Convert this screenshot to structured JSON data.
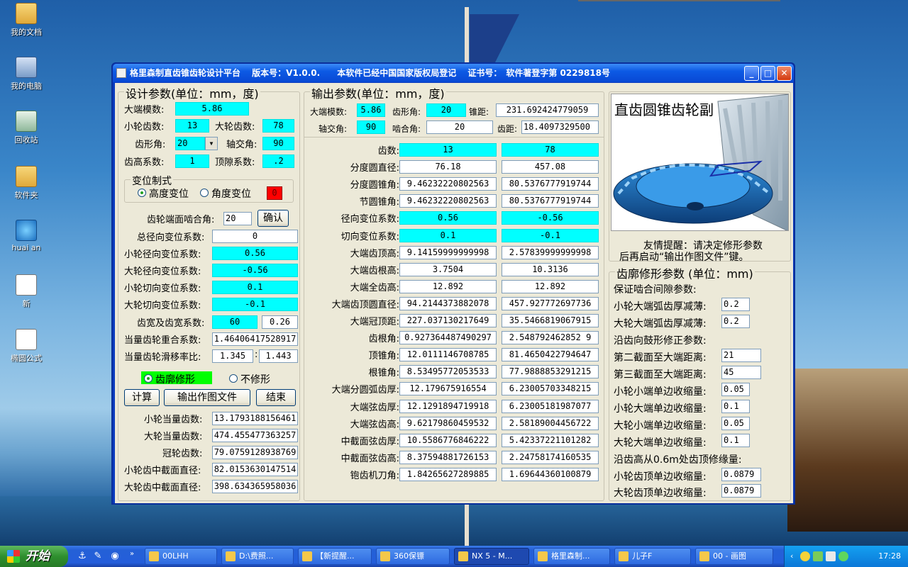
{
  "desktop": {
    "icons": [
      {
        "label": "我的文档",
        "icon": "folder-icon"
      },
      {
        "label": "我的电脑",
        "icon": "computer-icon"
      },
      {
        "label": "回收站",
        "icon": "recycle-bin-icon"
      },
      {
        "label": "软件夹",
        "icon": "folder-icon"
      },
      {
        "label": "huai an",
        "icon": "network-icon"
      },
      {
        "label": "新",
        "icon": "document-icon"
      },
      {
        "label": "椭圆公式",
        "icon": "document-icon"
      }
    ]
  },
  "window": {
    "title": "格里森制直齿锥齿轮设计平台　 版本号：V1.0.0.　　本软件已经中国国家版权局登记　 证书号：　软件著登字第 0229818号",
    "minimize": "_",
    "maximize": "□",
    "close": "✕"
  },
  "design": {
    "title": "设计参数(单位：mm，度)",
    "module_label": "大端模数:",
    "module": "5.86",
    "pinion_teeth_label": "小轮齿数:",
    "pinion_teeth": "13",
    "gear_teeth_label": "大轮齿数:",
    "gear_teeth": "78",
    "pressure_angle_label": "齿形角:",
    "pressure_angle": "20",
    "shaft_angle_label": "轴交角:",
    "shaft_angle": "90",
    "addendum_coef_label": "齿高系数:",
    "addendum_coef": "1",
    "clearance_coef_label": "顶隙系数:",
    "clearance_coef": ".2",
    "shift_system_title": "变位制式",
    "height_shift": "高度变位",
    "angle_shift": "角度变位",
    "shift_flag": "0",
    "mesh_angle_label": "齿轮端面啮合角:",
    "mesh_angle": "20",
    "confirm": "确认",
    "total_shift_label": "总径向变位系数:",
    "total_shift": "0",
    "pinion_radial_label": "小轮径向变位系数:",
    "pinion_radial": "0.56",
    "gear_radial_label": "大轮径向变位系数:",
    "gear_radial": "-0.56",
    "pinion_tangential_label": "小轮切向变位系数:",
    "pinion_tangential": "0.1",
    "gear_tangential_label": "大轮切向变位系数:",
    "gear_tangential": "-0.1",
    "face_width_label": "齿宽及齿宽系数:",
    "face_width": "60",
    "face_width_coef": "0.26",
    "contact_ratio_label": "当量齿轮重合系数:",
    "contact_ratio": "1.46406417528917",
    "slide_ratio_label": "当量齿轮滑移率比:",
    "slide_ratio_1": "1.345",
    "slide_sep": ":",
    "slide_ratio_2": "1.443",
    "profile_mod": "齿廓修形",
    "no_mod": "不修形",
    "calc": "计算",
    "export": "输出作图文件",
    "finish": "结束",
    "pinion_equiv_label": "小轮当量齿数:",
    "pinion_equiv": "13.1793188156461",
    "gear_equiv_label": "大轮当量齿数:",
    "gear_equiv": "474.455477363257",
    "crown_label": "冠轮齿数:",
    "crown": "79.0759128938769",
    "pinion_mid_label": "小轮齿中截面直径:",
    "pinion_mid": "82.0153630147514",
    "gear_mid_label": "大轮齿中截面直径:",
    "gear_mid": "398.634365958036"
  },
  "output": {
    "title": "输出参数(单位：mm，度)",
    "module_label": "大端模数:",
    "module": "5.86",
    "pa_label": "齿形角:",
    "pa": "20",
    "cone_label": "锥距:",
    "cone": "231.692424779059",
    "shaft_label": "轴交角:",
    "shaft": "90",
    "mesh_label": "啮合角:",
    "mesh": "20",
    "pitch_label": "齿距:",
    "pitch": "18.4097329500",
    "rows": [
      {
        "label": "齿数:",
        "a": "13",
        "b": "78",
        "cyan": true
      },
      {
        "label": "分度圆直径:",
        "a": "76.18",
        "b": "457.08",
        "cyan": false
      },
      {
        "label": "分度圆锥角:",
        "a": "9.46232220802563",
        "b": "80.5376777919744",
        "cyan": false
      },
      {
        "label": "节圆锥角:",
        "a": "9.46232220802563",
        "b": "80.5376777919744",
        "cyan": false
      },
      {
        "label": "径向变位系数:",
        "a": "0.56",
        "b": "-0.56",
        "cyan": true
      },
      {
        "label": "切向变位系数:",
        "a": "0.1",
        "b": "-0.1",
        "cyan": true
      },
      {
        "label": "大端齿顶高:",
        "a": "9.14159999999998",
        "b": "2.57839999999998",
        "cyan": false
      },
      {
        "label": "大端齿根高:",
        "a": "3.7504",
        "b": "10.3136",
        "cyan": false
      },
      {
        "label": "大端全齿高:",
        "a": "12.892",
        "b": "12.892",
        "cyan": false
      },
      {
        "label": "大端齿顶圆直径:",
        "a": "94.2144373882078",
        "b": "457.927772697736",
        "cyan": false
      },
      {
        "label": "大端冠顶距:",
        "a": "227.037130217649",
        "b": "35.5466819067915",
        "cyan": false
      },
      {
        "label": "齿根角:",
        "a": "0.927364487490297",
        "b": "2.548792462852 9",
        "cyan": false
      },
      {
        "label": "顶锥角:",
        "a": "12.0111146708785",
        "b": "81.4650422794647",
        "cyan": false
      },
      {
        "label": "根锥角:",
        "a": "8.53495772053533",
        "b": "77.9888853291215",
        "cyan": false
      },
      {
        "label": "大端分圆弧齿厚:",
        "a": "12.179675916554",
        "b": "6.23005703348215",
        "cyan": false
      },
      {
        "label": "大端弦齿厚:",
        "a": "12.1291894719918",
        "b": "6.23005181987077",
        "cyan": false
      },
      {
        "label": "大端弦齿高:",
        "a": "9.62179860459532",
        "b": "2.58189004456722",
        "cyan": false
      },
      {
        "label": "中截面弦齿厚:",
        "a": "10.5586776846222",
        "b": "5.42337221101282",
        "cyan": false
      },
      {
        "label": "中截面弦齿高:",
        "a": "8.37594881726153",
        "b": "2.24758174160535",
        "cyan": false
      },
      {
        "label": "铇齿机刀角:",
        "a": "1.84265627289885",
        "b": "1.69644360100879",
        "cyan": false
      }
    ]
  },
  "preview": {
    "title": "直齿圆锥齿轮副",
    "tip_line1": "友情提醒：请决定修形参数",
    "tip_line2": "后再启动“输出作图文件”键。"
  },
  "mod": {
    "title": "齿廓修形参数 (单位：mm)",
    "backlash_title": "保证啮合间隙参数:",
    "pinion_thin_label": "小轮大端弧齿厚减薄:",
    "pinion_thin": "0.2",
    "gear_thin_label": "大轮大端弧齿厚减薄:",
    "gear_thin": "0.2",
    "crown_title": "沿齿向鼓形修正参数:",
    "sec2_label": "第二截面至大端距离:",
    "sec2": "21",
    "sec3_label": "第三截面至大端距离:",
    "sec3": "45",
    "p_small_label": "小轮小端单边收缩量:",
    "p_small": "0.05",
    "p_large_label": "小轮大端单边收缩量:",
    "p_large": "0.1",
    "g_small_label": "大轮小端单边收缩量:",
    "g_small": "0.05",
    "g_large_label": "大轮大端单边收缩量:",
    "g_large": "0.1",
    "tip_title": "沿齿高从0.6m处齿顶修缘量:",
    "p_tip_label": "小轮齿顶单边收缩量:",
    "p_tip": "0.0879",
    "g_tip_label": "大轮齿顶单边收缩量:",
    "g_tip": "0.0879"
  },
  "taskbar": {
    "start": "开始",
    "tasks": [
      "00LHH",
      "D:\\费照...",
      "【新提醒...",
      "360保镖",
      "NX 5 - M...",
      "格里森制...",
      "儿子F",
      "00 - 画图"
    ],
    "clock": "17:28"
  }
}
